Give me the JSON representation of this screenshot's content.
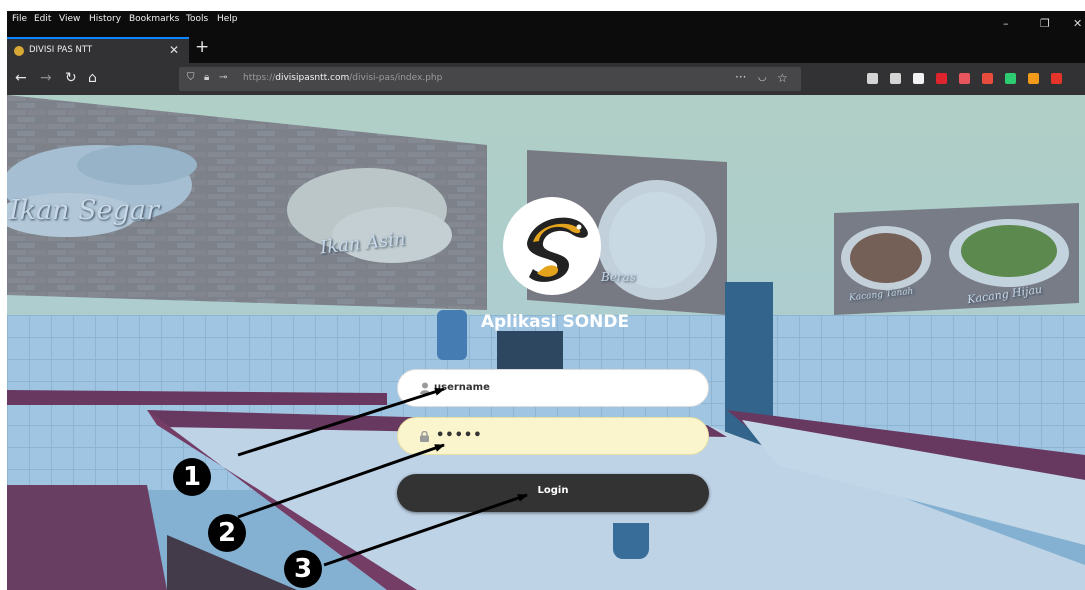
{
  "browser": {
    "menu": [
      "File",
      "Edit",
      "View",
      "History",
      "Bookmarks",
      "Tools",
      "Help"
    ],
    "tab_title": "DIVISI PAS NTT",
    "url_prefix": "https://",
    "url_domain": "divisipasntt.com",
    "url_path": "/divisi-pas/index.php",
    "page_actions": "···",
    "toolbar_icons": [
      "library-icon",
      "sidebar-icon",
      "account-icon",
      "mega-icon",
      "pocket-icon",
      "adblock-icon",
      "screenshot-icon",
      "extension-icon",
      "opera-icon"
    ],
    "toolbar_icon_colors": [
      "#d5d5d5",
      "#d5d5d5",
      "#f2f2f2",
      "#e0242e",
      "#e8555d",
      "#e74c3c",
      "#2ecc71",
      "#f29b1b",
      "#e5352b"
    ]
  },
  "background": {
    "poster_labels": [
      "Ikan Segar",
      "Ikan Asin",
      "Beras",
      "Kacang Tanah",
      "Kacang Hijau"
    ]
  },
  "app": {
    "title": "Aplikasi SONDE",
    "username_value": "username",
    "password_value": "•••••",
    "login_label": "Login",
    "accent": "#333333",
    "password_field_color": "#fbf5cd"
  },
  "annotations": {
    "steps": [
      "1",
      "2",
      "3"
    ]
  }
}
